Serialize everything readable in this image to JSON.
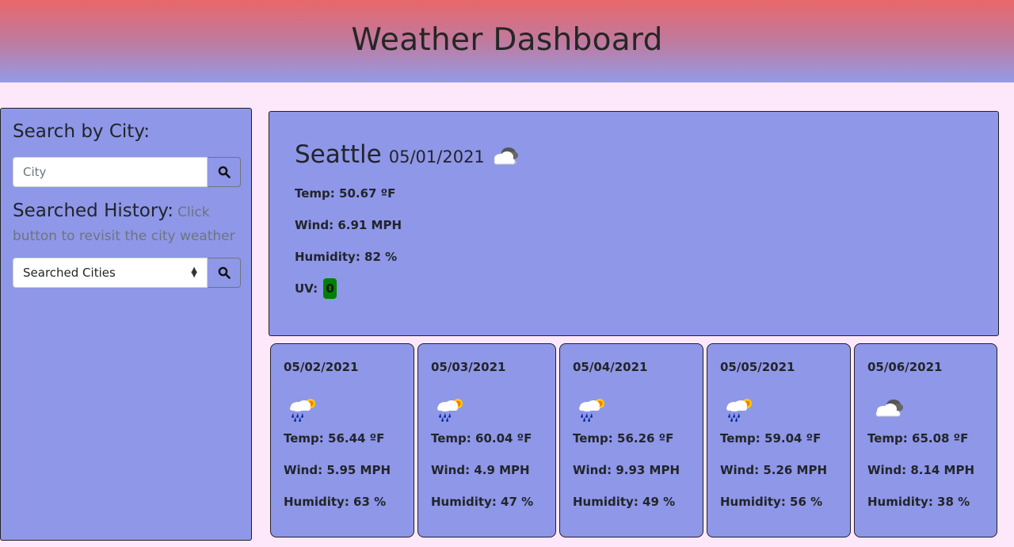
{
  "header": {
    "title": "Weather Dashboard"
  },
  "search": {
    "title": "Search by City:",
    "placeholder": "City",
    "button_icon": "search-icon"
  },
  "history": {
    "title": "Searched History:",
    "hint": "Click button to revisit the city weather",
    "select_value": "Searched Cities",
    "button_icon": "search-icon"
  },
  "today": {
    "city": "Seattle",
    "date": "05/01/2021",
    "icon": "cloudy-icon",
    "temp": "Temp: 50.67 ºF",
    "wind": "Wind: 6.91 MPH",
    "humidity": "Humidity: 82 %",
    "uv_label": "UV:",
    "uv_value": "0",
    "uv_color": "#008000"
  },
  "forecast": [
    {
      "date": "05/02/2021",
      "icon": "rain-sun-icon",
      "temp": "Temp: 56.44 ºF",
      "wind": "Wind: 5.95 MPH",
      "humidity": "Humidity: 63 %"
    },
    {
      "date": "05/03/2021",
      "icon": "rain-sun-icon",
      "temp": "Temp: 60.04 ºF",
      "wind": "Wind: 4.9 MPH",
      "humidity": "Humidity: 47 %"
    },
    {
      "date": "05/04/2021",
      "icon": "rain-sun-icon",
      "temp": "Temp: 56.26 ºF",
      "wind": "Wind: 9.93 MPH",
      "humidity": "Humidity: 49 %"
    },
    {
      "date": "05/05/2021",
      "icon": "rain-sun-icon",
      "temp": "Temp: 59.04 ºF",
      "wind": "Wind: 5.26 MPH",
      "humidity": "Humidity: 56 %"
    },
    {
      "date": "05/06/2021",
      "icon": "cloudy-icon",
      "temp": "Temp: 65.08 ºF",
      "wind": "Wind: 8.14 MPH",
      "humidity": "Humidity: 38 %"
    }
  ],
  "colors": {
    "header_top": "#e8676a",
    "header_bottom": "#939be6",
    "page_bg": "#fde8fb",
    "card_bg": "#8f97e8",
    "uv_low": "#008000"
  }
}
